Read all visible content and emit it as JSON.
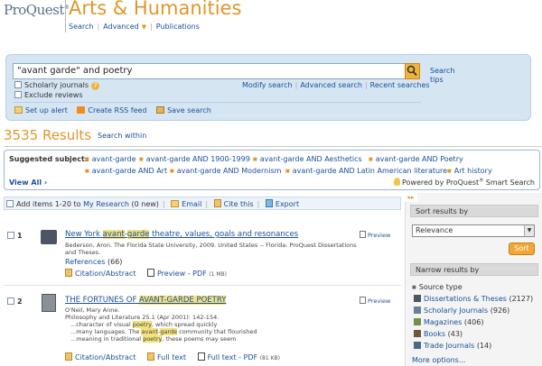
{
  "brand": {
    "logo_text": "ProQuest",
    "logo_mark": "®",
    "title": "Arts & Humanities"
  },
  "nav": {
    "search": "Search",
    "advanced": "Advanced",
    "advanced_icon": "chevron-down-icon",
    "publications": "Publications"
  },
  "search": {
    "query": "\"avant garde\" and poetry",
    "scholarly": "Scholarly journals",
    "exclude": "Exclude reviews",
    "modify": "Modify search",
    "advanced": "Advanced search",
    "recent": "Recent searches",
    "tips": "Search tips"
  },
  "actions": {
    "alert": "Set up alert",
    "rss": "Create RSS feed",
    "save": "Save search"
  },
  "results": {
    "count": "3535 Results",
    "within": "Search within"
  },
  "suggest": {
    "title": "Suggested subjects",
    "items": [
      "avant-garde",
      "avant-garde AND 1900-1999",
      "avant-garde AND Aesthetics",
      "avant-garde AND Poetry",
      "avant-garde AND Art",
      "avant-garde AND Modernism",
      "avant-garde AND Latin American literature",
      "Art history"
    ],
    "view_all": "View All ›",
    "powered_prefix": "Powered by ProQuest",
    "powered_mark": "®",
    "powered_suffix": "Smart Search"
  },
  "bar": {
    "add_prefix": "Add items 1-20 to ",
    "my_research": "My Research",
    "add_suffix": " (0 new)",
    "email": "Email",
    "cite": "Cite this",
    "export": "Export"
  },
  "result1": {
    "num": "1",
    "title_a": "New York ",
    "title_hl1": "avant",
    "title_b": "-",
    "title_hl2": "garde",
    "title_c": " theatre, values, goals and resonances",
    "meta1": "Bederson, Aron. The Florida State University, 2009. United States -- Florida: ProQuest Dissertations",
    "meta2": "and Theses.",
    "refs": "References",
    "refs_n": "(66)",
    "citation": "Citation/Abstract",
    "preview_pdf": "Preview - PDF",
    "size": "(1 MB)",
    "preview": "Preview"
  },
  "result2": {
    "num": "2",
    "title_a": "THE FORTUNES OF ",
    "title_hl": "AVANT-GARDE POETRY",
    "meta1": "O'Neil, Mary Anne.",
    "meta2": "Philosophy and Literature 25.1 (Apr 2001): 142-154.",
    "s1a": "...character of visual ",
    "s1hl": "poetry",
    "s1b": ", which spread quickly",
    "s2": "...many languages. The ",
    "s2hl1": "avant",
    "s2m": "-",
    "s2hl2": "garde",
    "s2b": " community that flourished",
    "s3a": "...meaning in traditional ",
    "s3hl": "poetry",
    "s3b": ", these poems may seem",
    "citation": "Citation/Abstract",
    "full_text": "Full text",
    "full_pdf": "Full text - PDF",
    "size": "(81 KB)",
    "preview": "Preview"
  },
  "side": {
    "collapse": "▸▸",
    "sort_by": "Sort results by",
    "sort_value": "Relevance",
    "sort_btn": "Sort",
    "narrow": "Narrow results by",
    "source_type": "Source type",
    "sources": [
      {
        "label": "Dissertations & Theses",
        "count": "(2127)"
      },
      {
        "label": "Scholarly Journals",
        "count": "(926)"
      },
      {
        "label": "Magazines",
        "count": "(406)"
      },
      {
        "label": "Books",
        "count": "(43)"
      },
      {
        "label": "Trade Journals",
        "count": "(14)"
      }
    ],
    "more": "More options..."
  }
}
